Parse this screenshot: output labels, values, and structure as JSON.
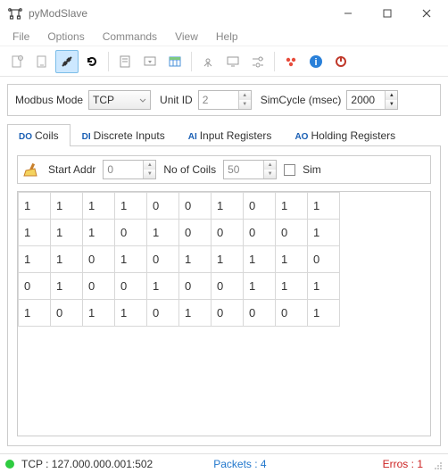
{
  "window": {
    "title": "pyModSlave"
  },
  "menu": {
    "file": "File",
    "options": "Options",
    "commands": "Commands",
    "view": "View",
    "help": "Help"
  },
  "config": {
    "modbus_mode_label": "Modbus Mode",
    "modbus_mode_value": "TCP",
    "unit_id_label": "Unit ID",
    "unit_id_value": "2",
    "simcycle_label": "SimCycle (msec)",
    "simcycle_value": "2000"
  },
  "tabs": {
    "coils_prefix": "DO",
    "coils_label": "Coils",
    "di_prefix": "DI",
    "di_label": "Discrete Inputs",
    "ai_prefix": "AI",
    "ai_label": "Input Registers",
    "ao_prefix": "AO",
    "ao_label": "Holding Registers"
  },
  "controls": {
    "start_addr_label": "Start Addr",
    "start_addr_value": "0",
    "no_of_coils_label": "No of Coils",
    "no_of_coils_value": "50",
    "sim_label": "Sim"
  },
  "grid": {
    "rows": [
      [
        "1",
        "1",
        "1",
        "1",
        "0",
        "0",
        "1",
        "0",
        "1",
        "1"
      ],
      [
        "1",
        "1",
        "1",
        "0",
        "1",
        "0",
        "0",
        "0",
        "0",
        "1"
      ],
      [
        "1",
        "1",
        "0",
        "1",
        "0",
        "1",
        "1",
        "1",
        "1",
        "0"
      ],
      [
        "0",
        "1",
        "0",
        "0",
        "1",
        "0",
        "0",
        "1",
        "1",
        "1"
      ],
      [
        "1",
        "0",
        "1",
        "1",
        "0",
        "1",
        "0",
        "0",
        "0",
        "1"
      ]
    ]
  },
  "status": {
    "tcp": "TCP : 127.000.000.001:502",
    "packets": "Packets : 4",
    "errors": "Erros : 1",
    "dot_color": "#2ecc40"
  }
}
